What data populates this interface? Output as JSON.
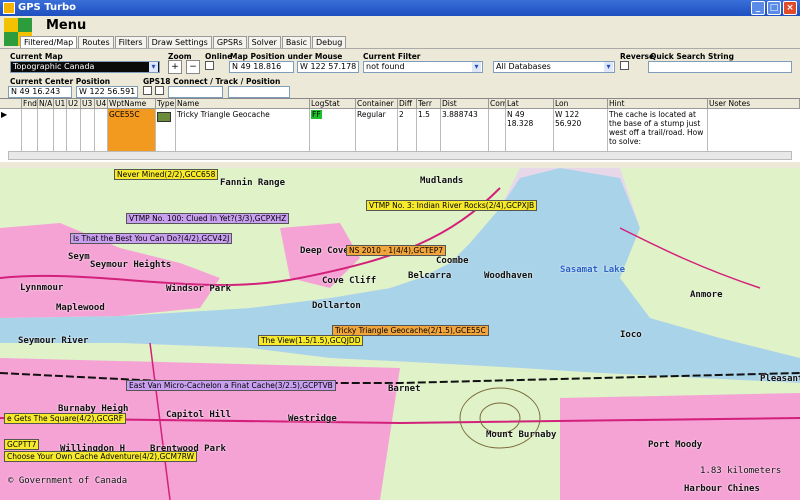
{
  "window": {
    "title": "GPS Turbo"
  },
  "menu": {
    "title": "Menu"
  },
  "tabs": [
    "Filtered/Map",
    "Routes",
    "Filters",
    "Draw Settings",
    "GPSRs",
    "Solver",
    "Basic",
    "Debug"
  ],
  "controls": {
    "current_map_label": "Current Map",
    "current_map_value": "Topographic Canada",
    "zoom_label": "Zoom",
    "online_label": "Online",
    "map_position_label": "Map Position under Mouse",
    "map_pos_lat": "N 49 18.816",
    "map_pos_lon": "W 122 57.178",
    "current_filter_label": "Current Filter",
    "current_filter_value": "not found",
    "database_value": "All Databases",
    "reverse_label": "Reverse",
    "quick_search_label": "Quick Search String",
    "quick_search_value": "",
    "center_label": "Current Center Position",
    "center_lat": "N 49 16.243",
    "center_lon": "W 122 56.591",
    "gps18_label": "GPS18 Connect / Track / Position"
  },
  "table": {
    "columns": [
      "Fnd",
      "N/A",
      "U1",
      "U2",
      "U3",
      "U4",
      "WptName",
      "Type",
      "Name",
      "LogStat",
      "Container",
      "Diff",
      "Terr",
      "Dist",
      "Corr",
      "Lat",
      "Lon",
      "Hint",
      "User Notes"
    ],
    "row": {
      "WptName": "GCE55C",
      "Name": "Tricky Triangle Geocache",
      "LogStat": "FF",
      "Container": "Regular",
      "Diff": "2",
      "Terr": "1.5",
      "Dist": "3.888743",
      "Lat": "N 49 18.328",
      "Lon": "W 122 56.920",
      "Hint": "The cache is located at the base of a stump just west off a trail/road. How to solve:"
    }
  },
  "map": {
    "places": [
      "Mudlands",
      "Fannin Range",
      "Seymour Heights",
      "Windsor Park",
      "Cove Cliff",
      "Deep Cove",
      "Dollarton",
      "Belcarra",
      "Woodhaven",
      "Coombe",
      "Sasamat Lake",
      "Maplewood",
      "Seymour River",
      "Anmore",
      "Ioco",
      "Barnet",
      "Pleasant",
      "Burnaby Heigh",
      "Capitol Hill",
      "Westridge",
      "Mount Burnaby",
      "Port Moody",
      "Brentwood Park",
      "Willingdon H",
      "Harbour Chines",
      "Lynnmour",
      "Seym"
    ],
    "caches": [
      {
        "label": "Never Mined(2/2),GCC658",
        "style": "y"
      },
      {
        "label": "VTMP No. 100: Clued In Yet?(3/3),GCPXHZ",
        "style": "p"
      },
      {
        "label": "Is That the Best You Can Do?(4/2),GCV42J",
        "style": "p"
      },
      {
        "label": "VTMP No. 3: Indian River Rocks(2/4),GCPXJB",
        "style": "y"
      },
      {
        "label": "NS 2010 - 1(4/4),GCTEP7",
        "style": "o"
      },
      {
        "label": "Tricky Triangle Geocache(2/1.5),GCE55C",
        "style": "o"
      },
      {
        "label": "The View(1.5/1.5),GCQJDD",
        "style": "y"
      },
      {
        "label": "East Van Micro-Cachelon a Finat Cache(3/2.5),GCPTVB",
        "style": "p"
      },
      {
        "label": "e Gets The Square(4/2),GCGRF",
        "style": "y"
      },
      {
        "label": "GCPTT7",
        "style": "y"
      },
      {
        "label": "Choose Your Own Cache Adventure(4/2),GCM7RW",
        "style": "y"
      }
    ],
    "scale": "1.83 kilometers",
    "copyright": "© Government of Canada"
  },
  "colors": {
    "water": "#a9d3e8",
    "land": "#dff2c8",
    "urban": "#f5a3d5",
    "road": "#d3207a"
  }
}
